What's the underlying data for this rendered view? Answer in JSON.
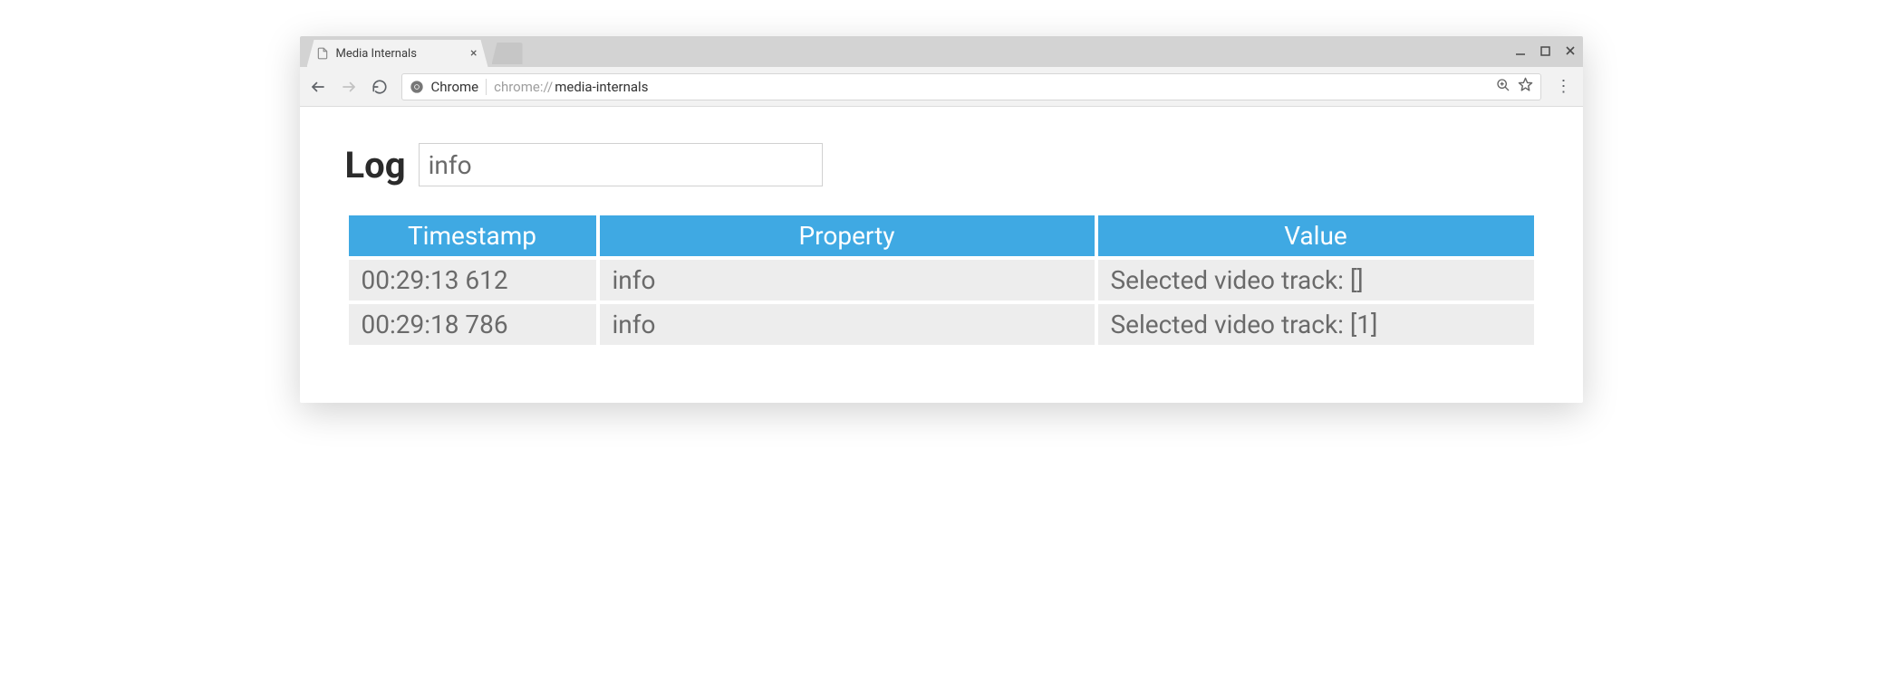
{
  "window": {
    "tab_title": "Media Internals"
  },
  "omnibox": {
    "source_label": "Chrome",
    "url_prefix": "chrome://",
    "url_path": "media-internals"
  },
  "page": {
    "heading": "Log",
    "filter_value": "info",
    "table": {
      "headers": {
        "timestamp": "Timestamp",
        "property": "Property",
        "value": "Value"
      },
      "rows": [
        {
          "timestamp": "00:29:13 612",
          "property": "info",
          "value": "Selected video track: []"
        },
        {
          "timestamp": "00:29:18 786",
          "property": "info",
          "value": "Selected video track: [1]"
        }
      ]
    }
  }
}
